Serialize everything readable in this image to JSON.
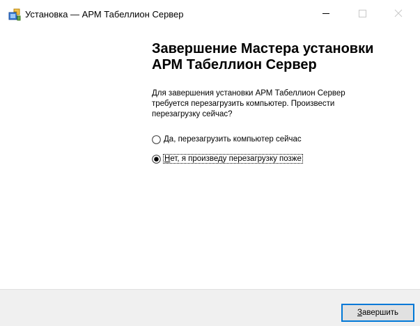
{
  "window": {
    "title": "Установка — АРМ Табеллион Сервер",
    "icons": {
      "app": "installer-icon",
      "minimize": "minimize-icon",
      "maximize": "maximize-icon",
      "close": "close-icon"
    }
  },
  "content": {
    "heading_line1": "Завершение Мастера установки",
    "heading_line2": "АРМ Табеллион Сервер",
    "description": "Для завершения установки АРМ Табеллион Сервер требуется перезагрузить компьютер. Произвести перезагрузку сейчас?",
    "options": [
      {
        "hotkey": "Д",
        "rest": "а, перезагрузить компьютер сейчас",
        "selected": false
      },
      {
        "hotkey": "Н",
        "rest": "ет, я произведу перезагрузку позже",
        "selected": true
      }
    ]
  },
  "footer": {
    "finish_hotkey": "З",
    "finish_rest": "авершить"
  },
  "colors": {
    "accent": "#0078d7",
    "footer_bg": "#f0f0f0"
  }
}
